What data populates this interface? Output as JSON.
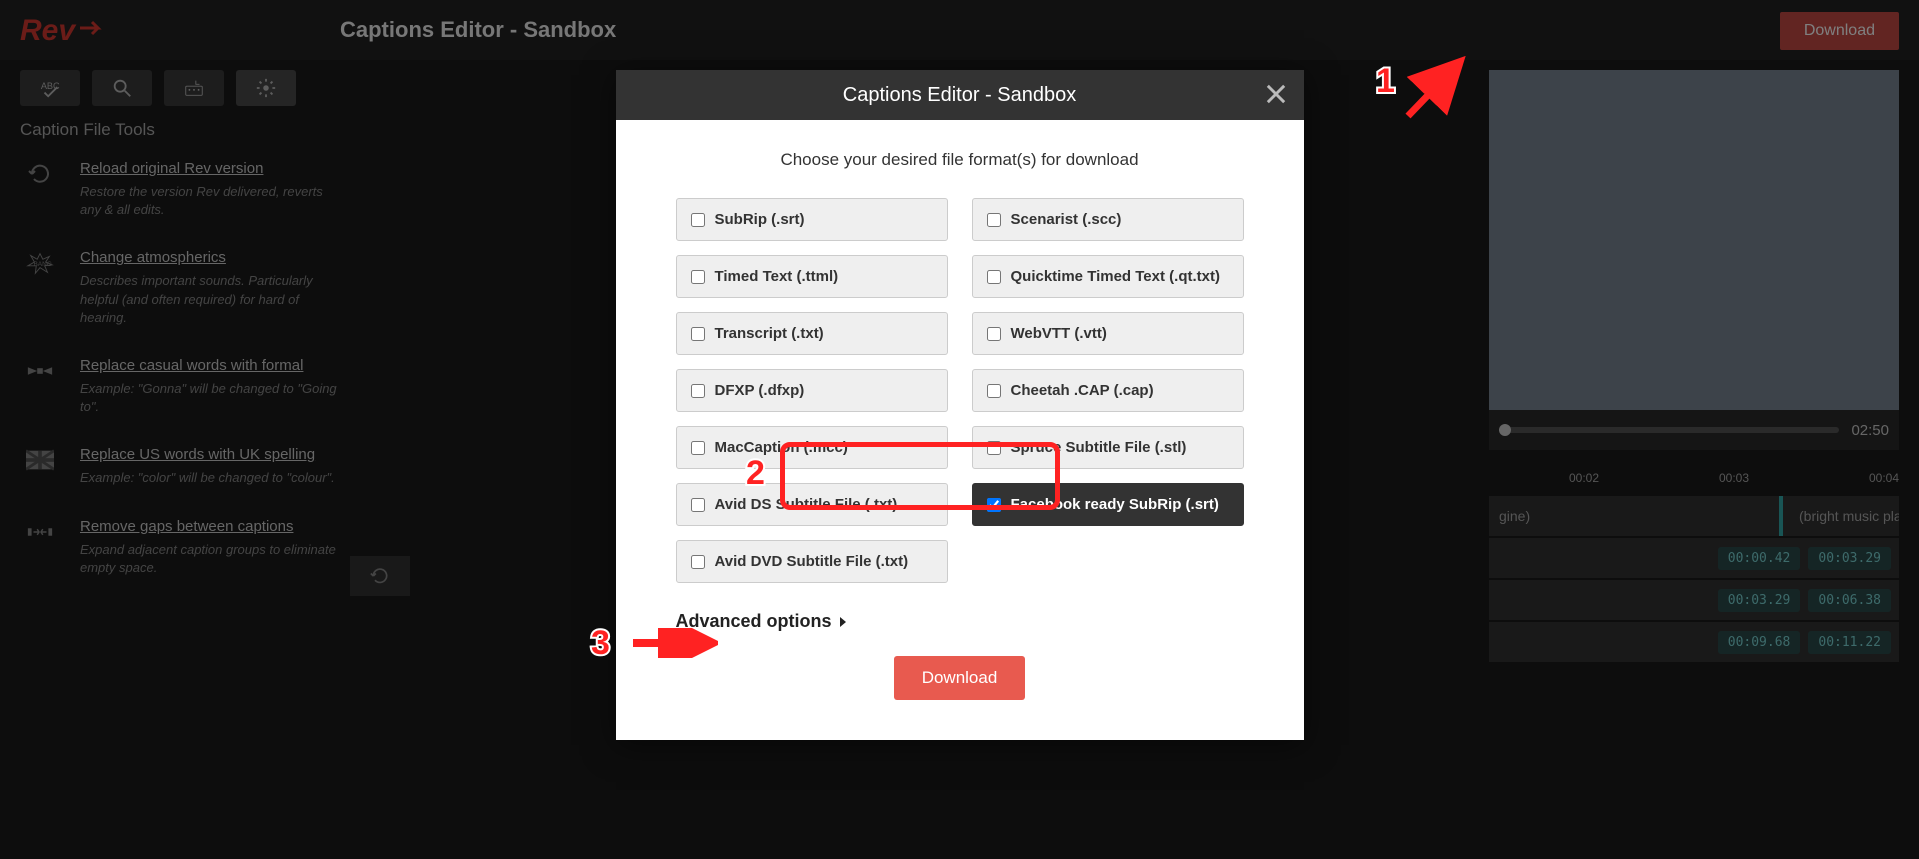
{
  "header": {
    "title": "Captions Editor - Sandbox",
    "download_label": "Download"
  },
  "sidebar": {
    "title": "Caption File Tools",
    "tools": [
      {
        "title": "Reload original Rev version",
        "desc": "Restore the version Rev delivered, reverts any & all edits."
      },
      {
        "title": "Change atmospherics",
        "desc": "Describes important sounds. Particularly helpful (and often required) for hard of hearing."
      },
      {
        "title": "Replace casual words with formal",
        "desc": "Example: \"Gonna\" will be changed to \"Going to\"."
      },
      {
        "title": "Replace US words with UK spelling",
        "desc": "Example: \"color\" will be changed to \"colour\"."
      },
      {
        "title": "Remove gaps between captions",
        "desc": "Expand adjacent caption groups to eliminate empty space."
      }
    ]
  },
  "video": {
    "time": "02:50"
  },
  "timeline": {
    "ticks": [
      "00:02",
      "00:03",
      "00:04"
    ],
    "rows": [
      {
        "label": "gine)",
        "start": "",
        "end": ""
      },
      {
        "label": "(bright music pla",
        "start": "",
        "end": ""
      }
    ],
    "codes": [
      {
        "start": "00:00.42",
        "end": "00:03.29"
      },
      {
        "start": "00:03.29",
        "end": "00:06.38"
      },
      {
        "start": "00:09.68",
        "end": "00:11.22"
      }
    ]
  },
  "modal": {
    "title": "Captions Editor - Sandbox",
    "subtitle": "Choose your desired file format(s) for download",
    "formats": [
      {
        "label": "SubRip (.srt)",
        "checked": false
      },
      {
        "label": "Scenarist (.scc)",
        "checked": false
      },
      {
        "label": "Timed Text (.ttml)",
        "checked": false
      },
      {
        "label": "Quicktime Timed Text (.qt.txt)",
        "checked": false
      },
      {
        "label": "Transcript (.txt)",
        "checked": false
      },
      {
        "label": "WebVTT (.vtt)",
        "checked": false
      },
      {
        "label": "DFXP (.dfxp)",
        "checked": false
      },
      {
        "label": "Cheetah .CAP (.cap)",
        "checked": false
      },
      {
        "label": "MacCaption (.mcc)",
        "checked": false
      },
      {
        "label": "Spruce Subtitle File (.stl)",
        "checked": false
      },
      {
        "label": "Avid DS Subtitle File (.txt)",
        "checked": false
      },
      {
        "label": "Facebook ready SubRip (.srt)",
        "checked": true
      },
      {
        "label": "Avid DVD Subtitle File (.txt)",
        "checked": false
      }
    ],
    "advanced_label": "Advanced options",
    "download_label": "Download"
  },
  "annotations": {
    "n1": "1",
    "n2": "2",
    "n3": "3"
  }
}
